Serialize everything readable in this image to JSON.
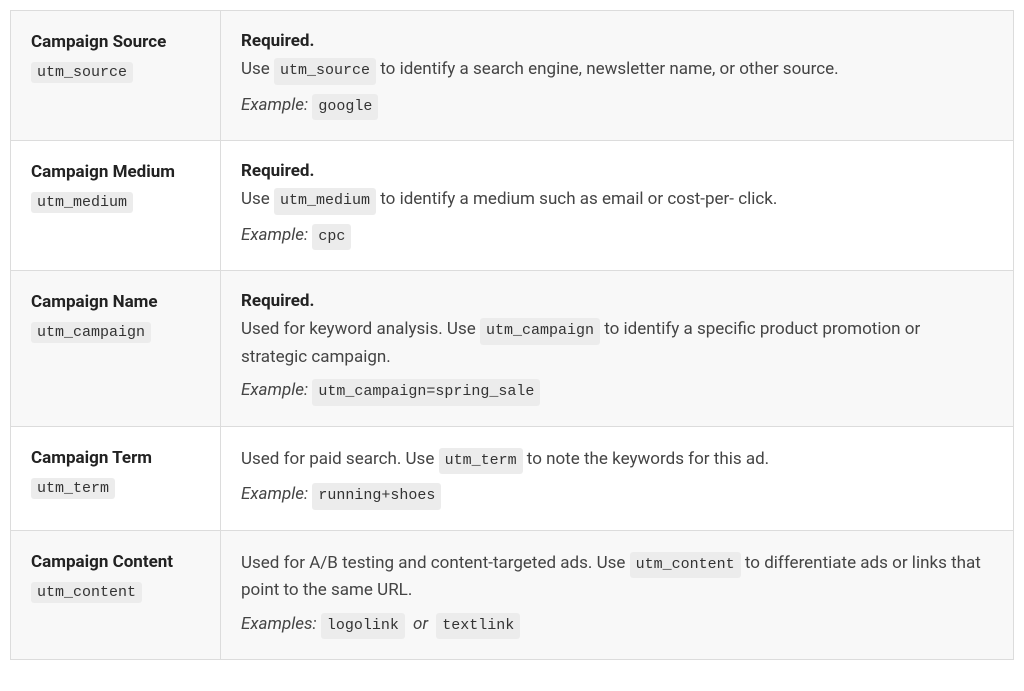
{
  "labels": {
    "required": "Required.",
    "example": "Example:",
    "examples": "Examples:",
    "or": "or",
    "use": "Use",
    "usedFor": "Used for"
  },
  "rows": [
    {
      "shaded": true,
      "title": "Campaign Source",
      "param": "utm_source",
      "required": true,
      "desc_pre": "Use ",
      "desc_code": "utm_source",
      "desc_post": " to identify a search engine, newsletter name, or other source.",
      "example_label": "Example:",
      "examples": [
        "google"
      ]
    },
    {
      "shaded": false,
      "title": "Campaign Medium",
      "param": "utm_medium",
      "required": true,
      "desc_pre": "Use ",
      "desc_code": "utm_medium",
      "desc_post": " to identify a medium such as email or cost-per- click.",
      "example_label": "Example:",
      "examples": [
        "cpc"
      ]
    },
    {
      "shaded": true,
      "title": "Campaign Name",
      "param": "utm_campaign",
      "required": true,
      "desc_pre": "Used for keyword analysis. Use ",
      "desc_code": "utm_campaign",
      "desc_post": " to identify a specific product promotion or strategic campaign.",
      "example_label": "Example:",
      "examples": [
        "utm_campaign=spring_sale"
      ]
    },
    {
      "shaded": false,
      "title": "Campaign Term",
      "param": "utm_term",
      "required": false,
      "desc_pre": "Used for paid search. Use ",
      "desc_code": "utm_term",
      "desc_post": " to note the keywords for this ad.",
      "example_label": "Example:",
      "examples": [
        "running+shoes"
      ]
    },
    {
      "shaded": true,
      "title": "Campaign Content",
      "param": "utm_content",
      "required": false,
      "desc_pre": "Used for A/B testing and content-targeted ads. Use ",
      "desc_code": "utm_content",
      "desc_post": " to differentiate ads or links that point to the same URL.",
      "example_label": "Examples:",
      "examples": [
        "logolink",
        "textlink"
      ]
    }
  ]
}
